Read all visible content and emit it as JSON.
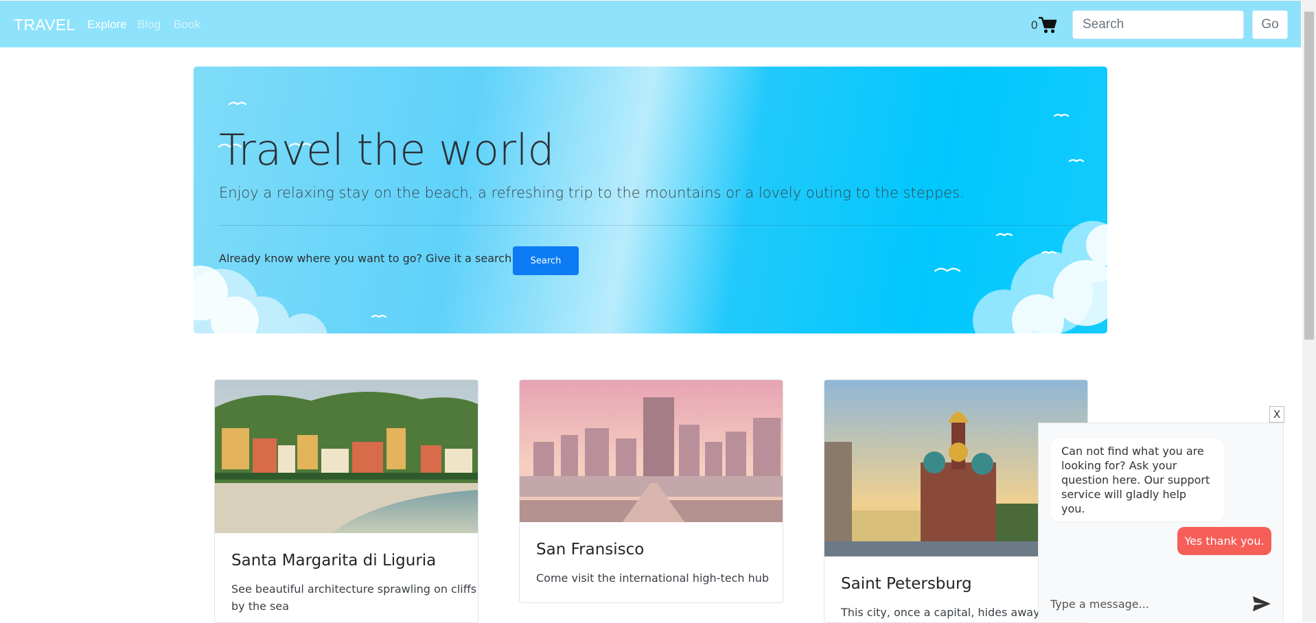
{
  "navbar": {
    "brand": "TRAVEL",
    "links": [
      "Explore",
      "Blog",
      "Book"
    ],
    "cart_count": "0",
    "search_placeholder": "Search",
    "go_label": "Go"
  },
  "hero": {
    "title": "Travel the world",
    "lead": "Enjoy a relaxing stay on the beach, a refreshing trip to the mountains or a lovely outing to the steppes.",
    "prompt": "Already know where you want to go? Give it a search",
    "search_label": "Search"
  },
  "cards": [
    {
      "title": "Santa Margarita di Liguria",
      "text_lines": [
        "See beautiful architecture sprawling on cliffs",
        "by the sea"
      ]
    },
    {
      "title": "San Fransisco",
      "text_lines": [
        "Come visit the international high-tech hub"
      ]
    },
    {
      "title": "Saint Petersburg",
      "text_lines": [
        "This city, once a capital, hides away"
      ]
    }
  ],
  "chat": {
    "close_label": "X",
    "incoming": "Can not find what you are looking for? Ask your question here. Our support service will gladly help you.",
    "outgoing": "Yes thank you.",
    "input_placeholder": "Type a message..."
  },
  "icons": {
    "cart": "shopping-cart-icon",
    "send": "paper-plane-send-icon"
  },
  "colors": {
    "navbar": "#8ee2fb",
    "hero_gradient": "#00c8fe",
    "primary_button": "#0c7bf4",
    "outgoing_bubble": "#f65e58"
  }
}
